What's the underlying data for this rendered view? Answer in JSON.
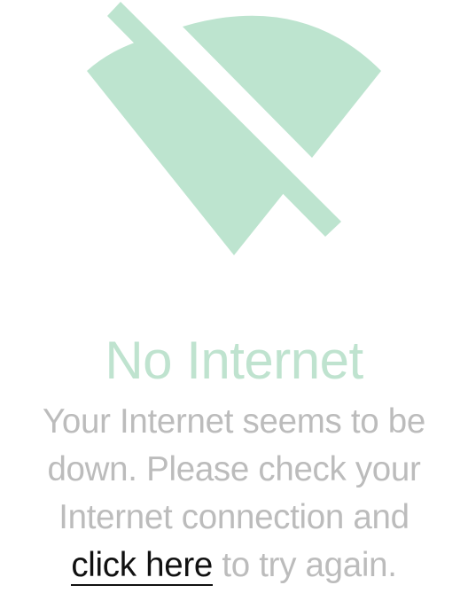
{
  "colors": {
    "accent_green": "#bfe3cf",
    "icon_fill": "#bde4cf",
    "message_gray": "#bcbcbc",
    "link_black": "#111111"
  },
  "icon": {
    "name": "wifi-off-icon"
  },
  "title": "No Internet",
  "message": {
    "line1": "Your Internet seems to be",
    "line2": "down. Please check your",
    "line3": "Internet connection and",
    "link_text": "click here",
    "line4_suffix": " to try again."
  }
}
